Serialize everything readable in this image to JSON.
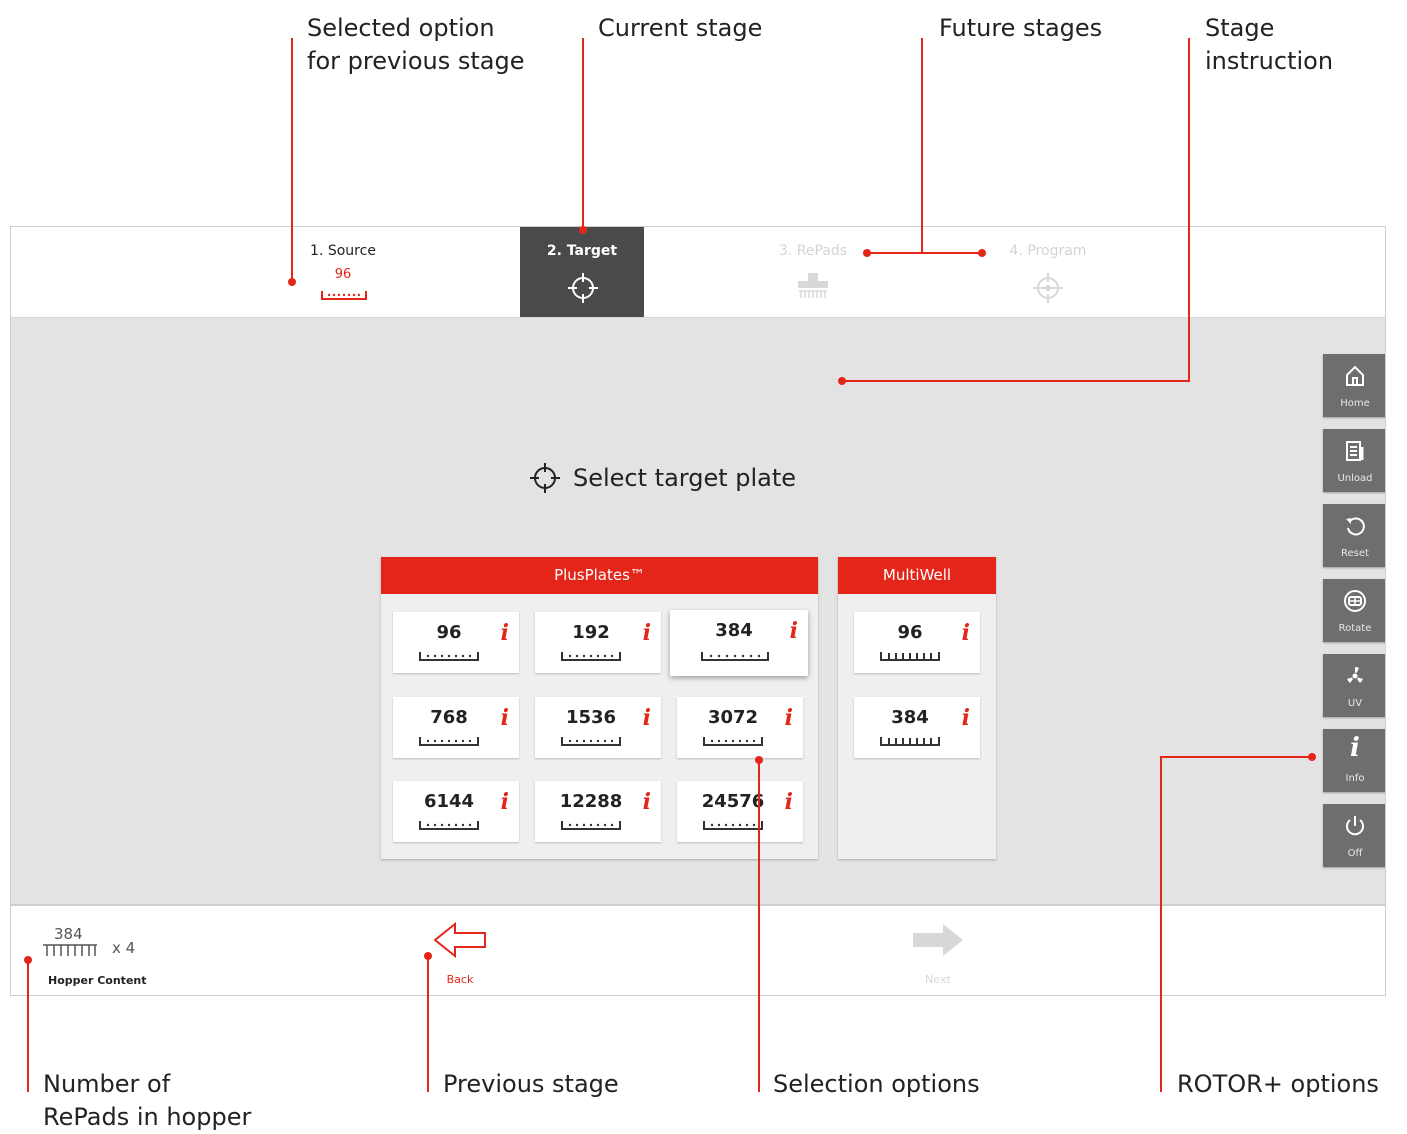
{
  "callouts": {
    "selected_previous": "Selected option\nfor previous stage",
    "current_stage": "Current stage",
    "future_stages": "Future stages",
    "stage_instruction": "Stage instruction",
    "repads_in_hopper": "Number of\nRePads in hopper",
    "previous_stage": "Previous stage",
    "selection_options": "Selection options",
    "rotor_options": "ROTOR+ options"
  },
  "stages": [
    {
      "label": "1. Source",
      "selected": "96",
      "state": "done"
    },
    {
      "label": "2. Target",
      "state": "current",
      "icon": "crosshair-icon"
    },
    {
      "label": "3. RePads",
      "state": "future",
      "icon": "repad-icon"
    },
    {
      "label": "4. Program",
      "state": "future",
      "icon": "program-icon"
    }
  ],
  "instruction": {
    "icon": "crosshair-icon",
    "text": "Select target plate"
  },
  "groups": [
    {
      "title": "PlusPlates™",
      "options": [
        {
          "value": "96",
          "info": "i"
        },
        {
          "value": "192",
          "info": "i"
        },
        {
          "value": "384",
          "info": "i",
          "selected": true
        },
        {
          "value": "768",
          "info": "i"
        },
        {
          "value": "1536",
          "info": "i"
        },
        {
          "value": "3072",
          "info": "i"
        },
        {
          "value": "6144",
          "info": "i"
        },
        {
          "value": "12288",
          "info": "i"
        },
        {
          "value": "24576",
          "info": "i"
        }
      ]
    },
    {
      "title": "MultiWell",
      "options": [
        {
          "value": "96",
          "info": "i"
        },
        {
          "value": "384",
          "info": "i"
        }
      ]
    }
  ],
  "sidebar": [
    {
      "label": "Home",
      "icon": "home-icon"
    },
    {
      "label": "Unload",
      "icon": "unload-icon"
    },
    {
      "label": "Reset",
      "icon": "reset-icon"
    },
    {
      "label": "Rotate",
      "icon": "rotate-icon"
    },
    {
      "label": "UV",
      "icon": "uv-icon"
    },
    {
      "label": "Info",
      "icon": "info-icon",
      "glyph": "i"
    },
    {
      "label": "Off",
      "icon": "power-icon"
    }
  ],
  "hopper": {
    "value": "384",
    "count": "x 4",
    "label": "Hopper Content"
  },
  "nav": {
    "back": "Back",
    "next": "Next"
  },
  "colors": {
    "accent": "#e4261a",
    "current_stage_bg": "#4a4a4a",
    "sidebar_bg": "#6e6e6e",
    "content_bg": "#e3e3e3"
  }
}
